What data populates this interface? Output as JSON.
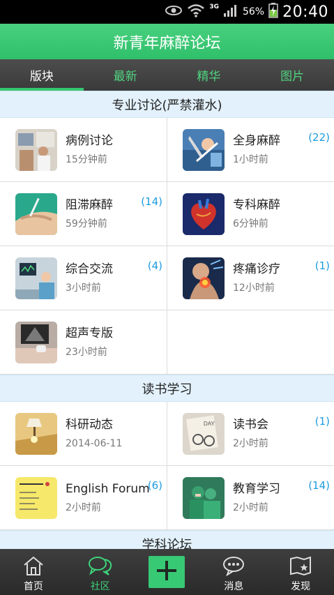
{
  "status_bar": {
    "network": "3G",
    "battery_percent": "56%",
    "time": "20:40"
  },
  "header": {
    "title": "新青年麻醉论坛"
  },
  "tabs": [
    {
      "label": "版块",
      "active": true
    },
    {
      "label": "最新",
      "active": false
    },
    {
      "label": "精华",
      "active": false
    },
    {
      "label": "图片",
      "active": false
    }
  ],
  "sections": [
    {
      "title": "专业讨论(严禁灌水)",
      "items": [
        {
          "name": "病例讨论",
          "time": "15分钟前",
          "count": "",
          "icon": "case-discussion-image"
        },
        {
          "name": "全身麻醉",
          "time": "1小时前",
          "count": "(22)",
          "icon": "general-anesthesia-image"
        },
        {
          "name": "阻滞麻醉",
          "time": "59分钟前",
          "count": "(14)",
          "icon": "nerve-block-image"
        },
        {
          "name": "专科麻醉",
          "time": "6分钟前",
          "count": "",
          "icon": "heart-image"
        },
        {
          "name": "综合交流",
          "time": "3小时前",
          "count": "(4)",
          "icon": "operating-room-image"
        },
        {
          "name": "疼痛诊疗",
          "time": "12小时前",
          "count": "(1)",
          "icon": "neck-pain-image"
        },
        {
          "name": "超声专版",
          "time": "23小时前",
          "count": "",
          "icon": "ultrasound-image"
        }
      ]
    },
    {
      "title": "读书学习",
      "items": [
        {
          "name": "科研动态",
          "time": "2014-06-11",
          "count": "",
          "icon": "research-image"
        },
        {
          "name": "读书会",
          "time": "2小时前",
          "count": "(1)",
          "icon": "book-club-image"
        },
        {
          "name": "English Forum",
          "time": "2小时前",
          "count": "(6)",
          "icon": "sticky-note-image"
        },
        {
          "name": "教育学习",
          "time": "2小时前",
          "count": "(14)",
          "icon": "education-image"
        }
      ]
    },
    {
      "title": "学科论坛",
      "items": []
    }
  ],
  "bottom_nav": {
    "home_label": "首页",
    "community_label": "社区",
    "messages_label": "消息",
    "discover_label": "发现"
  },
  "colors": {
    "accent": "#36c76f",
    "count": "#1e9be0",
    "section_bg": "#e2f1fb"
  }
}
